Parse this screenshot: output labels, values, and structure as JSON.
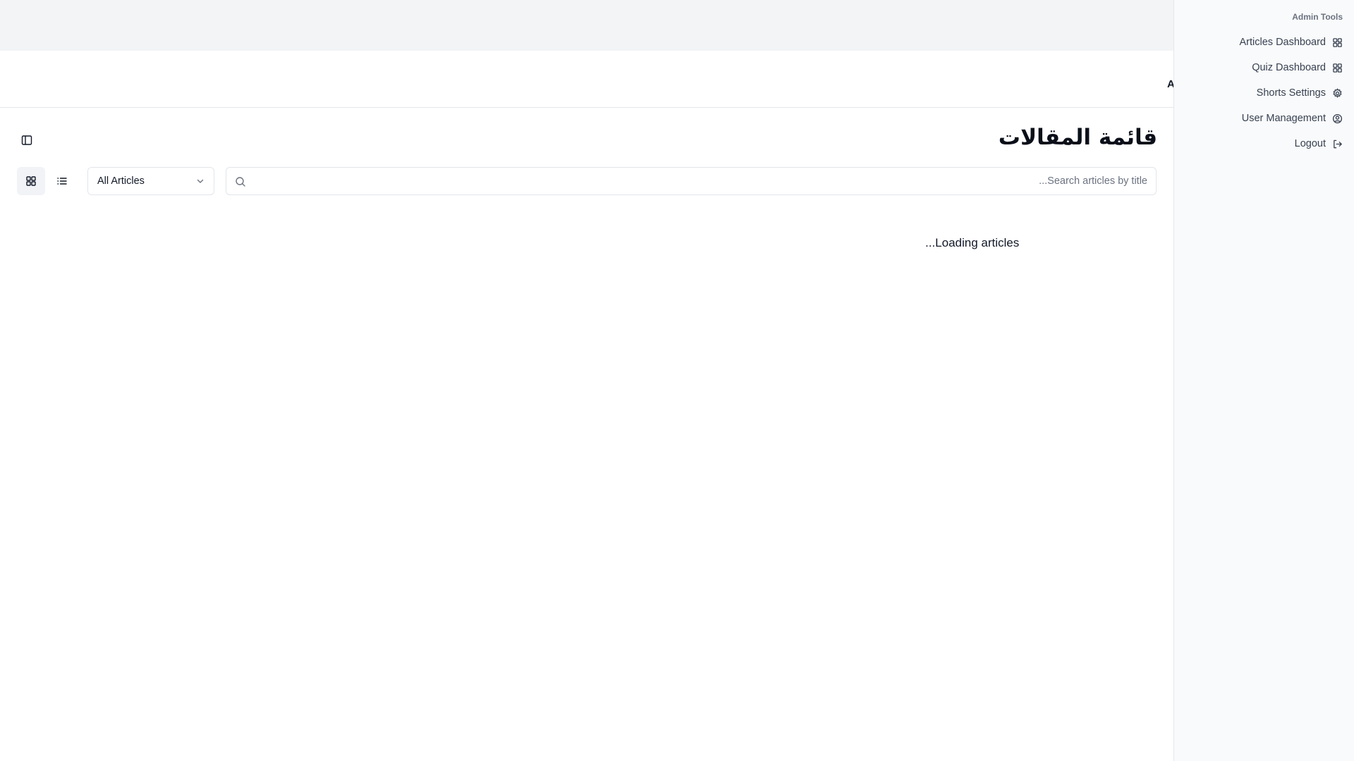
{
  "header": {
    "clipped_text": "A"
  },
  "page": {
    "title": "قائمة المقالات",
    "loading_text": "...Loading articles"
  },
  "view_toggle": {
    "options": [
      {
        "icon": "grid-icon",
        "active": true
      },
      {
        "icon": "list-icon",
        "active": false
      }
    ]
  },
  "filter": {
    "selected": "All Articles"
  },
  "search": {
    "placeholder": "...Search articles by title",
    "value": ""
  },
  "admin_panel": {
    "heading": "Admin Tools",
    "items": [
      {
        "label": "Articles Dashboard",
        "icon": "dashboard-icon"
      },
      {
        "label": "Quiz Dashboard",
        "icon": "dashboard-icon"
      },
      {
        "label": "Shorts Settings",
        "icon": "gear-icon"
      },
      {
        "label": "User Management",
        "icon": "user-circle-icon"
      },
      {
        "label": "Logout",
        "icon": "logout-icon"
      }
    ]
  },
  "colors": {
    "top_band": "#f3f4f6",
    "panel_bg": "#f9fafb",
    "border": "#e5e7eb",
    "text_primary": "#111827",
    "text_muted": "#6b7280"
  }
}
